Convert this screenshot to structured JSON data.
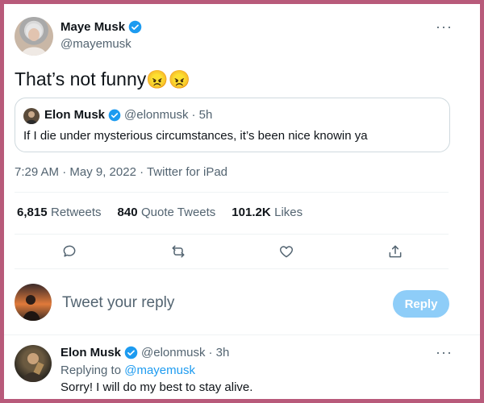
{
  "tweet": {
    "author_name": "Maye Musk",
    "author_handle": "@mayemusk",
    "text": "That’s not funny",
    "emoji": "😠😠",
    "timestamp": "7:29 AM · May 9, 2022 · Twitter for iPad"
  },
  "quoted": {
    "author_name": "Elon Musk",
    "author_handle": "@elonmusk",
    "age": "· 5h",
    "text": "If I die under mysterious circumstances, it’s been nice knowin ya"
  },
  "stats": {
    "retweets_count": "6,815",
    "retweets_label": "Retweets",
    "quotes_count": "840",
    "quotes_label": "Quote Tweets",
    "likes_count": "101.2K",
    "likes_label": "Likes"
  },
  "composer": {
    "placeholder": "Tweet your reply",
    "reply_button": "Reply"
  },
  "reply": {
    "author_name": "Elon Musk",
    "author_handle": "@elonmusk",
    "age": "· 3h",
    "replying_to_prefix": "Replying to",
    "replying_to_handle": "@mayemusk",
    "text": "Sorry! I will do my best to stay alive."
  },
  "more_label": "···",
  "colors": {
    "frame_border": "#b85a7a",
    "accent": "#1d9bf0",
    "reply_button_disabled": "#8ecdf8"
  },
  "icons": [
    "verified-badge-icon",
    "more-options-icon",
    "reply-icon",
    "retweet-icon",
    "like-icon",
    "share-icon"
  ]
}
